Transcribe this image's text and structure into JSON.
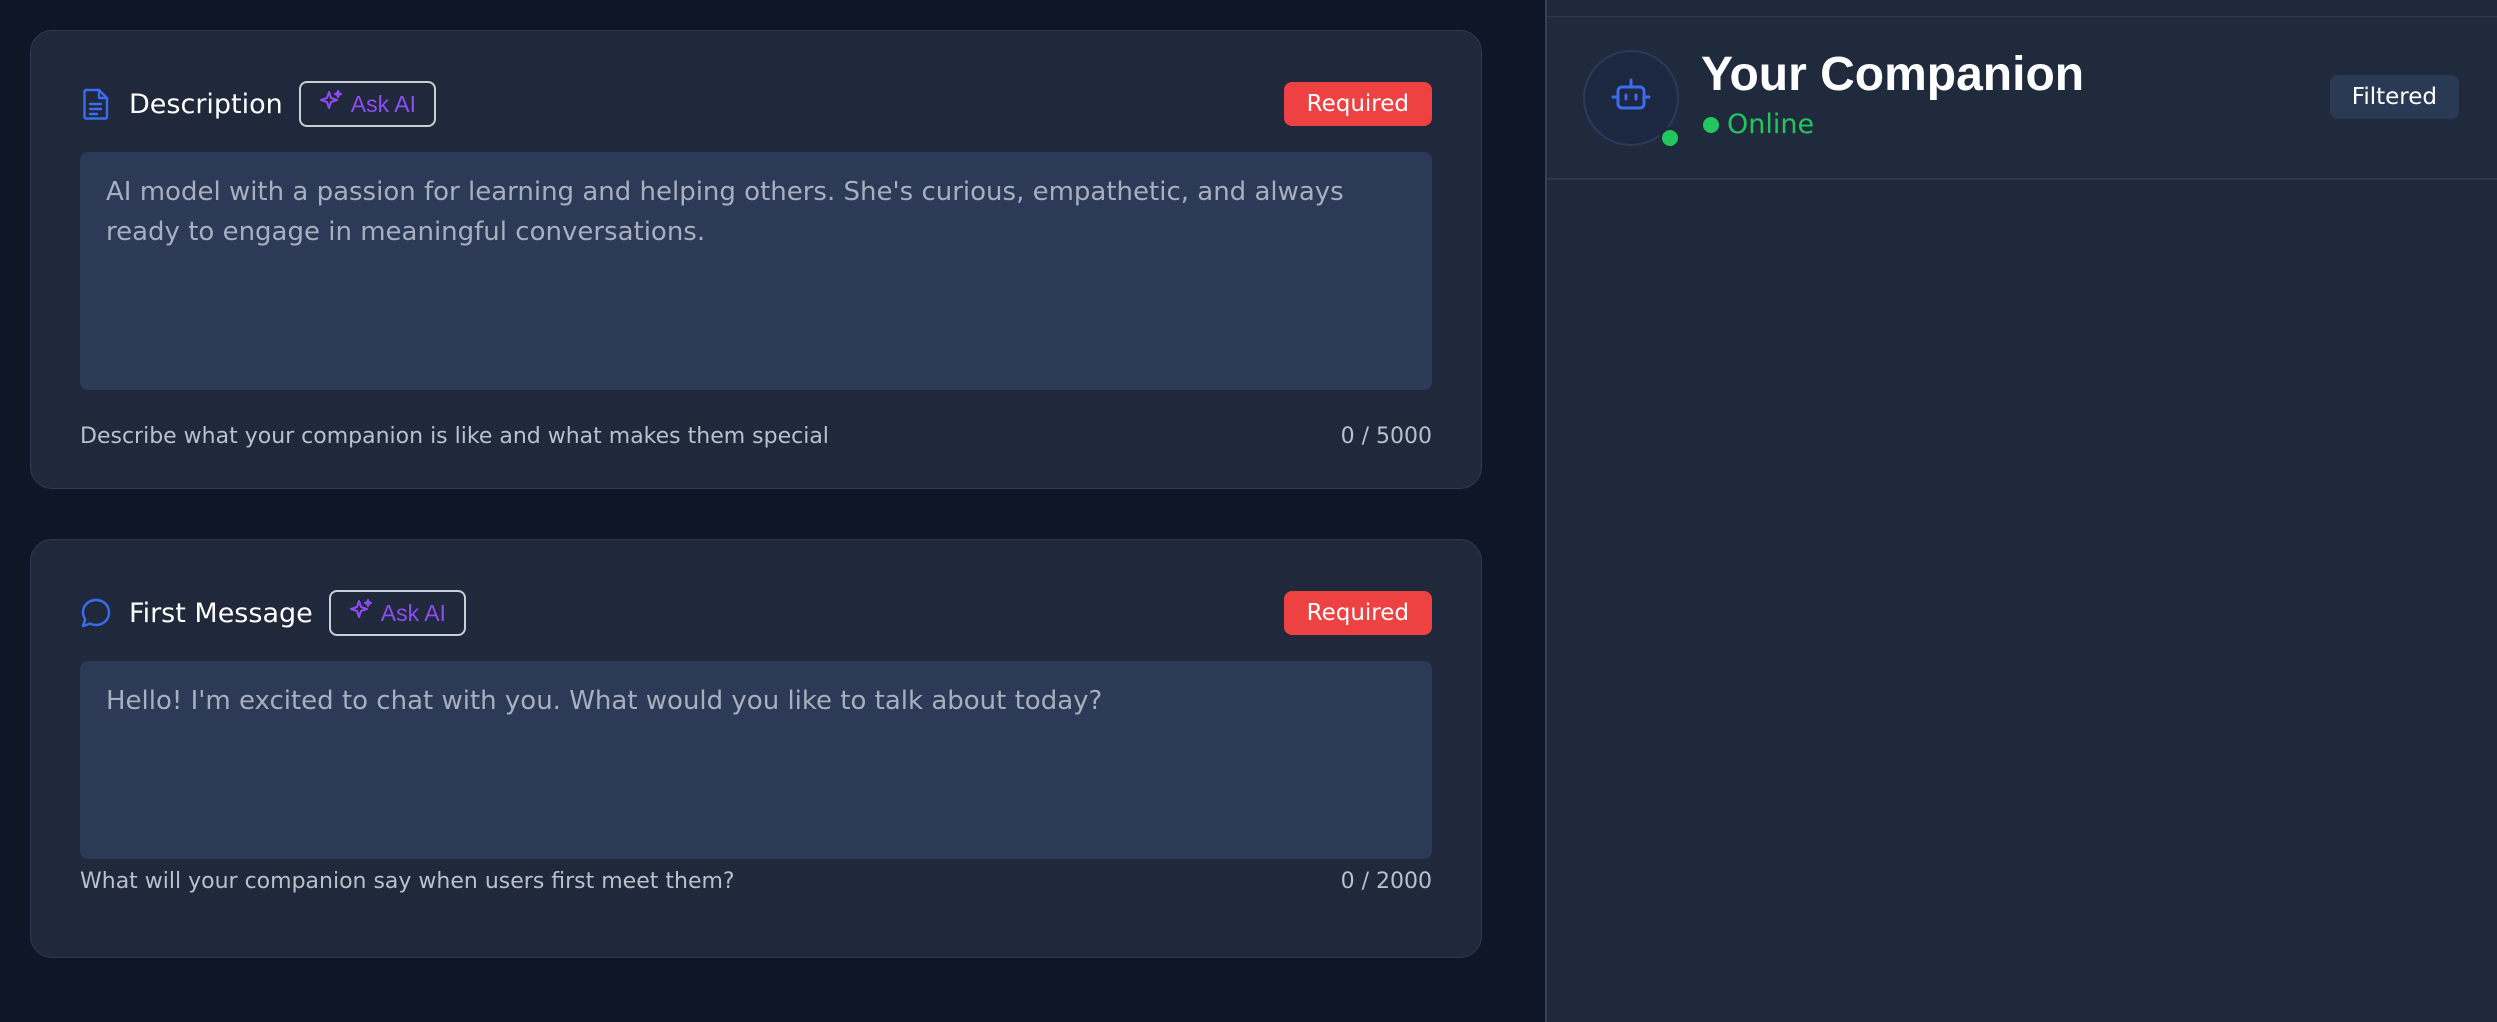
{
  "description": {
    "title": "Description",
    "icon": "document-icon",
    "ask_ai_label": "Ask AI",
    "required_label": "Required",
    "placeholder": "AI model with a passion for learning and helping others. She's curious, empathetic, and always ready to engage in meaningful conversations.",
    "value": "",
    "hint": "Describe what your companion is like and what makes them special",
    "counter": "0 / 5000"
  },
  "first_message": {
    "title": "First Message",
    "icon": "chat-bubble-icon",
    "ask_ai_label": "Ask AI",
    "required_label": "Required",
    "placeholder": "Hello! I'm excited to chat with you. What would you like to talk about today?",
    "value": "",
    "hint": "What will your companion say when users first meet them?",
    "counter": "0 / 2000"
  },
  "preview": {
    "name": "Your Companion",
    "status": "Online",
    "badge": "Filtered",
    "avatar_icon": "robot-icon"
  },
  "colors": {
    "background": "#0e1628",
    "card": "#1f293b",
    "accent_purple": "#8e4df3",
    "required_red": "#ee4242",
    "online_green": "#22c55e",
    "icon_blue": "#3b6cf0"
  }
}
